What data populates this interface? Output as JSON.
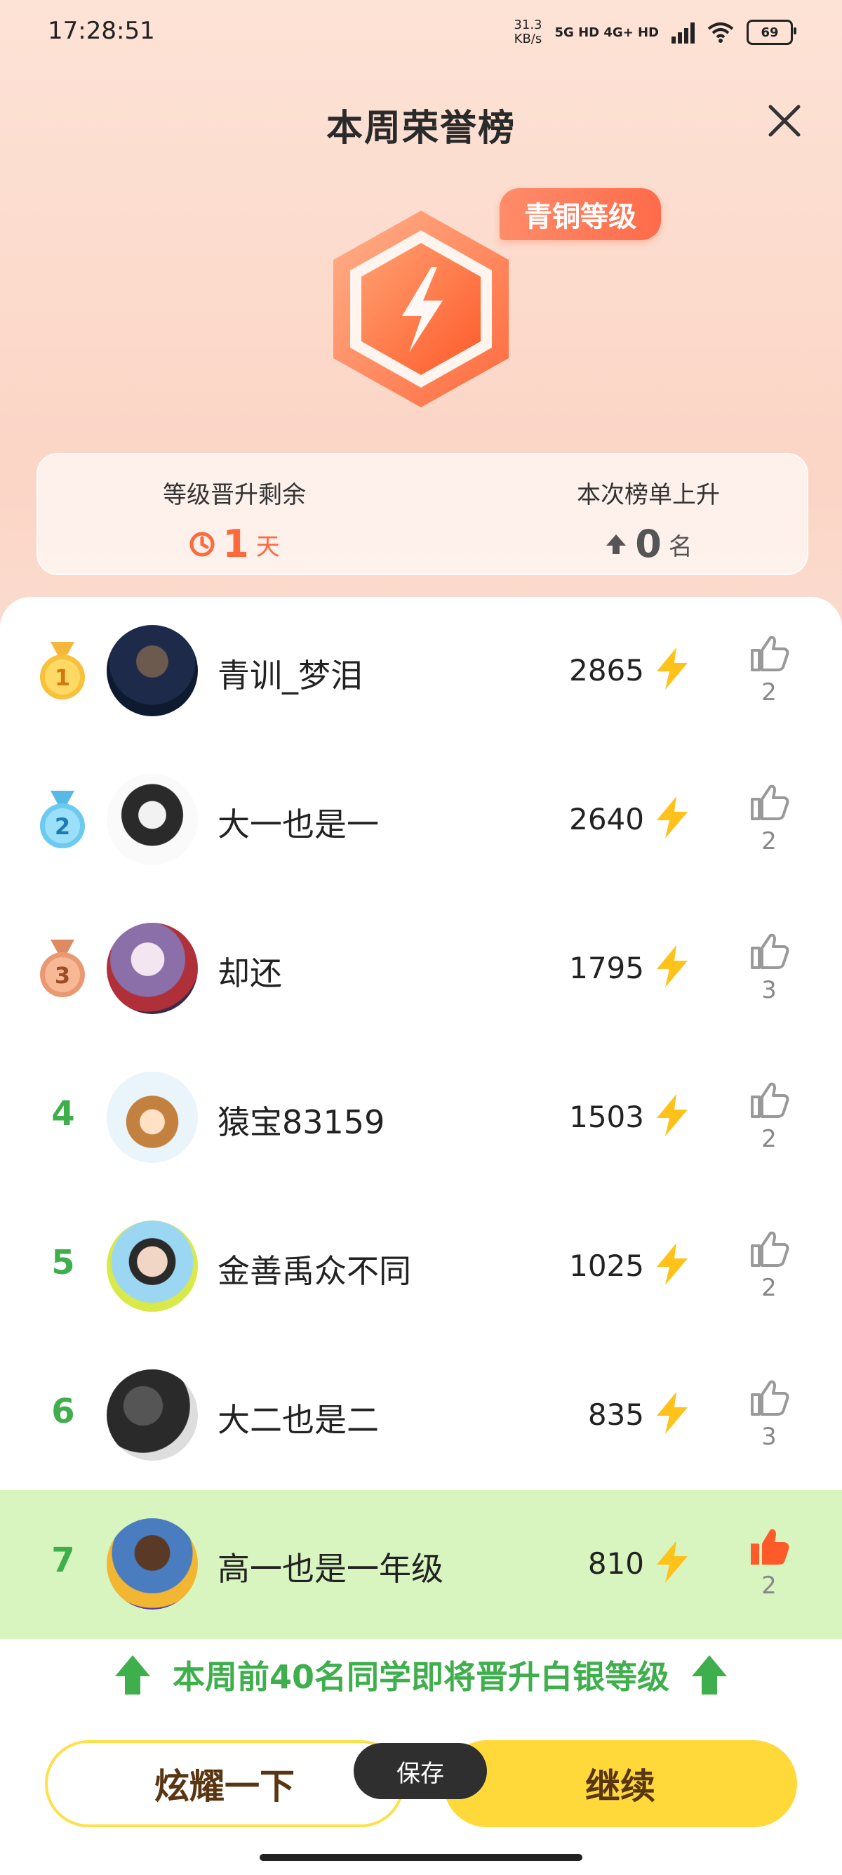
{
  "status_bar": {
    "time": "17:28:51",
    "net_speed": "31.3",
    "net_unit": "KB/s",
    "net_types": "5G HD  4G+ HD",
    "battery": "69"
  },
  "header": {
    "title": "本周荣誉榜"
  },
  "badge": {
    "tier_label": "青铜等级",
    "icon": "lightning-hexagon-icon"
  },
  "stats": {
    "left": {
      "label": "等级晋升剩余",
      "value": "1",
      "unit": "天",
      "icon": "clock-icon"
    },
    "right": {
      "label": "本次榜单上升",
      "value": "0",
      "unit": "名",
      "icon": "up-arrow-icon"
    }
  },
  "leaderboard": [
    {
      "rank": "1",
      "name": "青训_梦泪",
      "score": "2865",
      "likes": "2",
      "liked": false
    },
    {
      "rank": "2",
      "name": "大一也是一",
      "score": "2640",
      "likes": "2",
      "liked": false
    },
    {
      "rank": "3",
      "name": "却还",
      "score": "1795",
      "likes": "3",
      "liked": false
    },
    {
      "rank": "4",
      "name": "猿宝83159",
      "score": "1503",
      "likes": "2",
      "liked": false
    },
    {
      "rank": "5",
      "name": "金善禹众不同",
      "score": "1025",
      "likes": "2",
      "liked": false
    },
    {
      "rank": "6",
      "name": "大二也是二",
      "score": "835",
      "likes": "3",
      "liked": false
    },
    {
      "rank": "7",
      "name": "高一也是一年级",
      "score": "810",
      "likes": "2",
      "liked": true
    }
  ],
  "promo_text": "本周前40名同学即将晋升白银等级",
  "buttons": {
    "show_off": "炫耀一下",
    "continue": "继续"
  },
  "toast": "保存",
  "colors": {
    "accent_orange": "#ff6a3d",
    "rank_green": "#3fae4d",
    "highlight_row": "#d8f5c0",
    "button_yellow": "#ffd93a"
  }
}
